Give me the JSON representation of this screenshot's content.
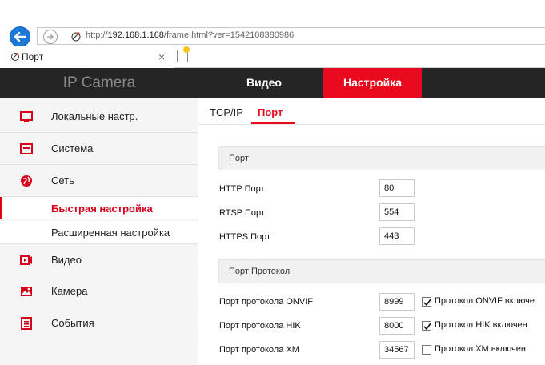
{
  "browser": {
    "url_prefix": "http://",
    "url_host": "192.168.1.168",
    "url_path": "/frame.html?ver=1542108380986",
    "tab_title": "Порт",
    "tab_close": "×"
  },
  "header": {
    "logo": "IP Camera",
    "nav": {
      "video": "Видео",
      "settings": "Настройка"
    },
    "accent": "#e8091f"
  },
  "sidebar": {
    "items": [
      {
        "label": "Локальные настр.",
        "icon": "monitor-icon"
      },
      {
        "label": "Система",
        "icon": "system-icon"
      },
      {
        "label": "Сеть",
        "icon": "globe-icon"
      }
    ],
    "subitems": [
      {
        "label": "Быстрая настройка",
        "active": true
      },
      {
        "label": "Расширенная настройка",
        "active": false
      }
    ],
    "items2": [
      {
        "label": "Видео",
        "icon": "video-icon"
      },
      {
        "label": "Камера",
        "icon": "image-icon"
      },
      {
        "label": "События",
        "icon": "events-icon"
      }
    ]
  },
  "main": {
    "tabs": {
      "tcpip": "TCP/IP",
      "port": "Порт"
    },
    "section_port": "Порт",
    "http_label": "HTTP Порт",
    "http_value": "80",
    "rtsp_label": "RTSP Порт",
    "rtsp_value": "554",
    "https_label": "HTTPS Порт",
    "https_value": "443",
    "section_protocol": "Порт Протокол",
    "onvif_label": "Порт протокола ONVIF",
    "onvif_value": "8999",
    "onvif_cb_label": "Протокол ONVIF включе",
    "onvif_checked": true,
    "hik_label": "Порт протокола HIK",
    "hik_value": "8000",
    "hik_cb_label": "Протокол HIK включен",
    "hik_checked": true,
    "xm_label": "Порт протокола XM",
    "xm_value": "34567",
    "xm_cb_label": "Протокол XM включен",
    "xm_checked": false
  }
}
